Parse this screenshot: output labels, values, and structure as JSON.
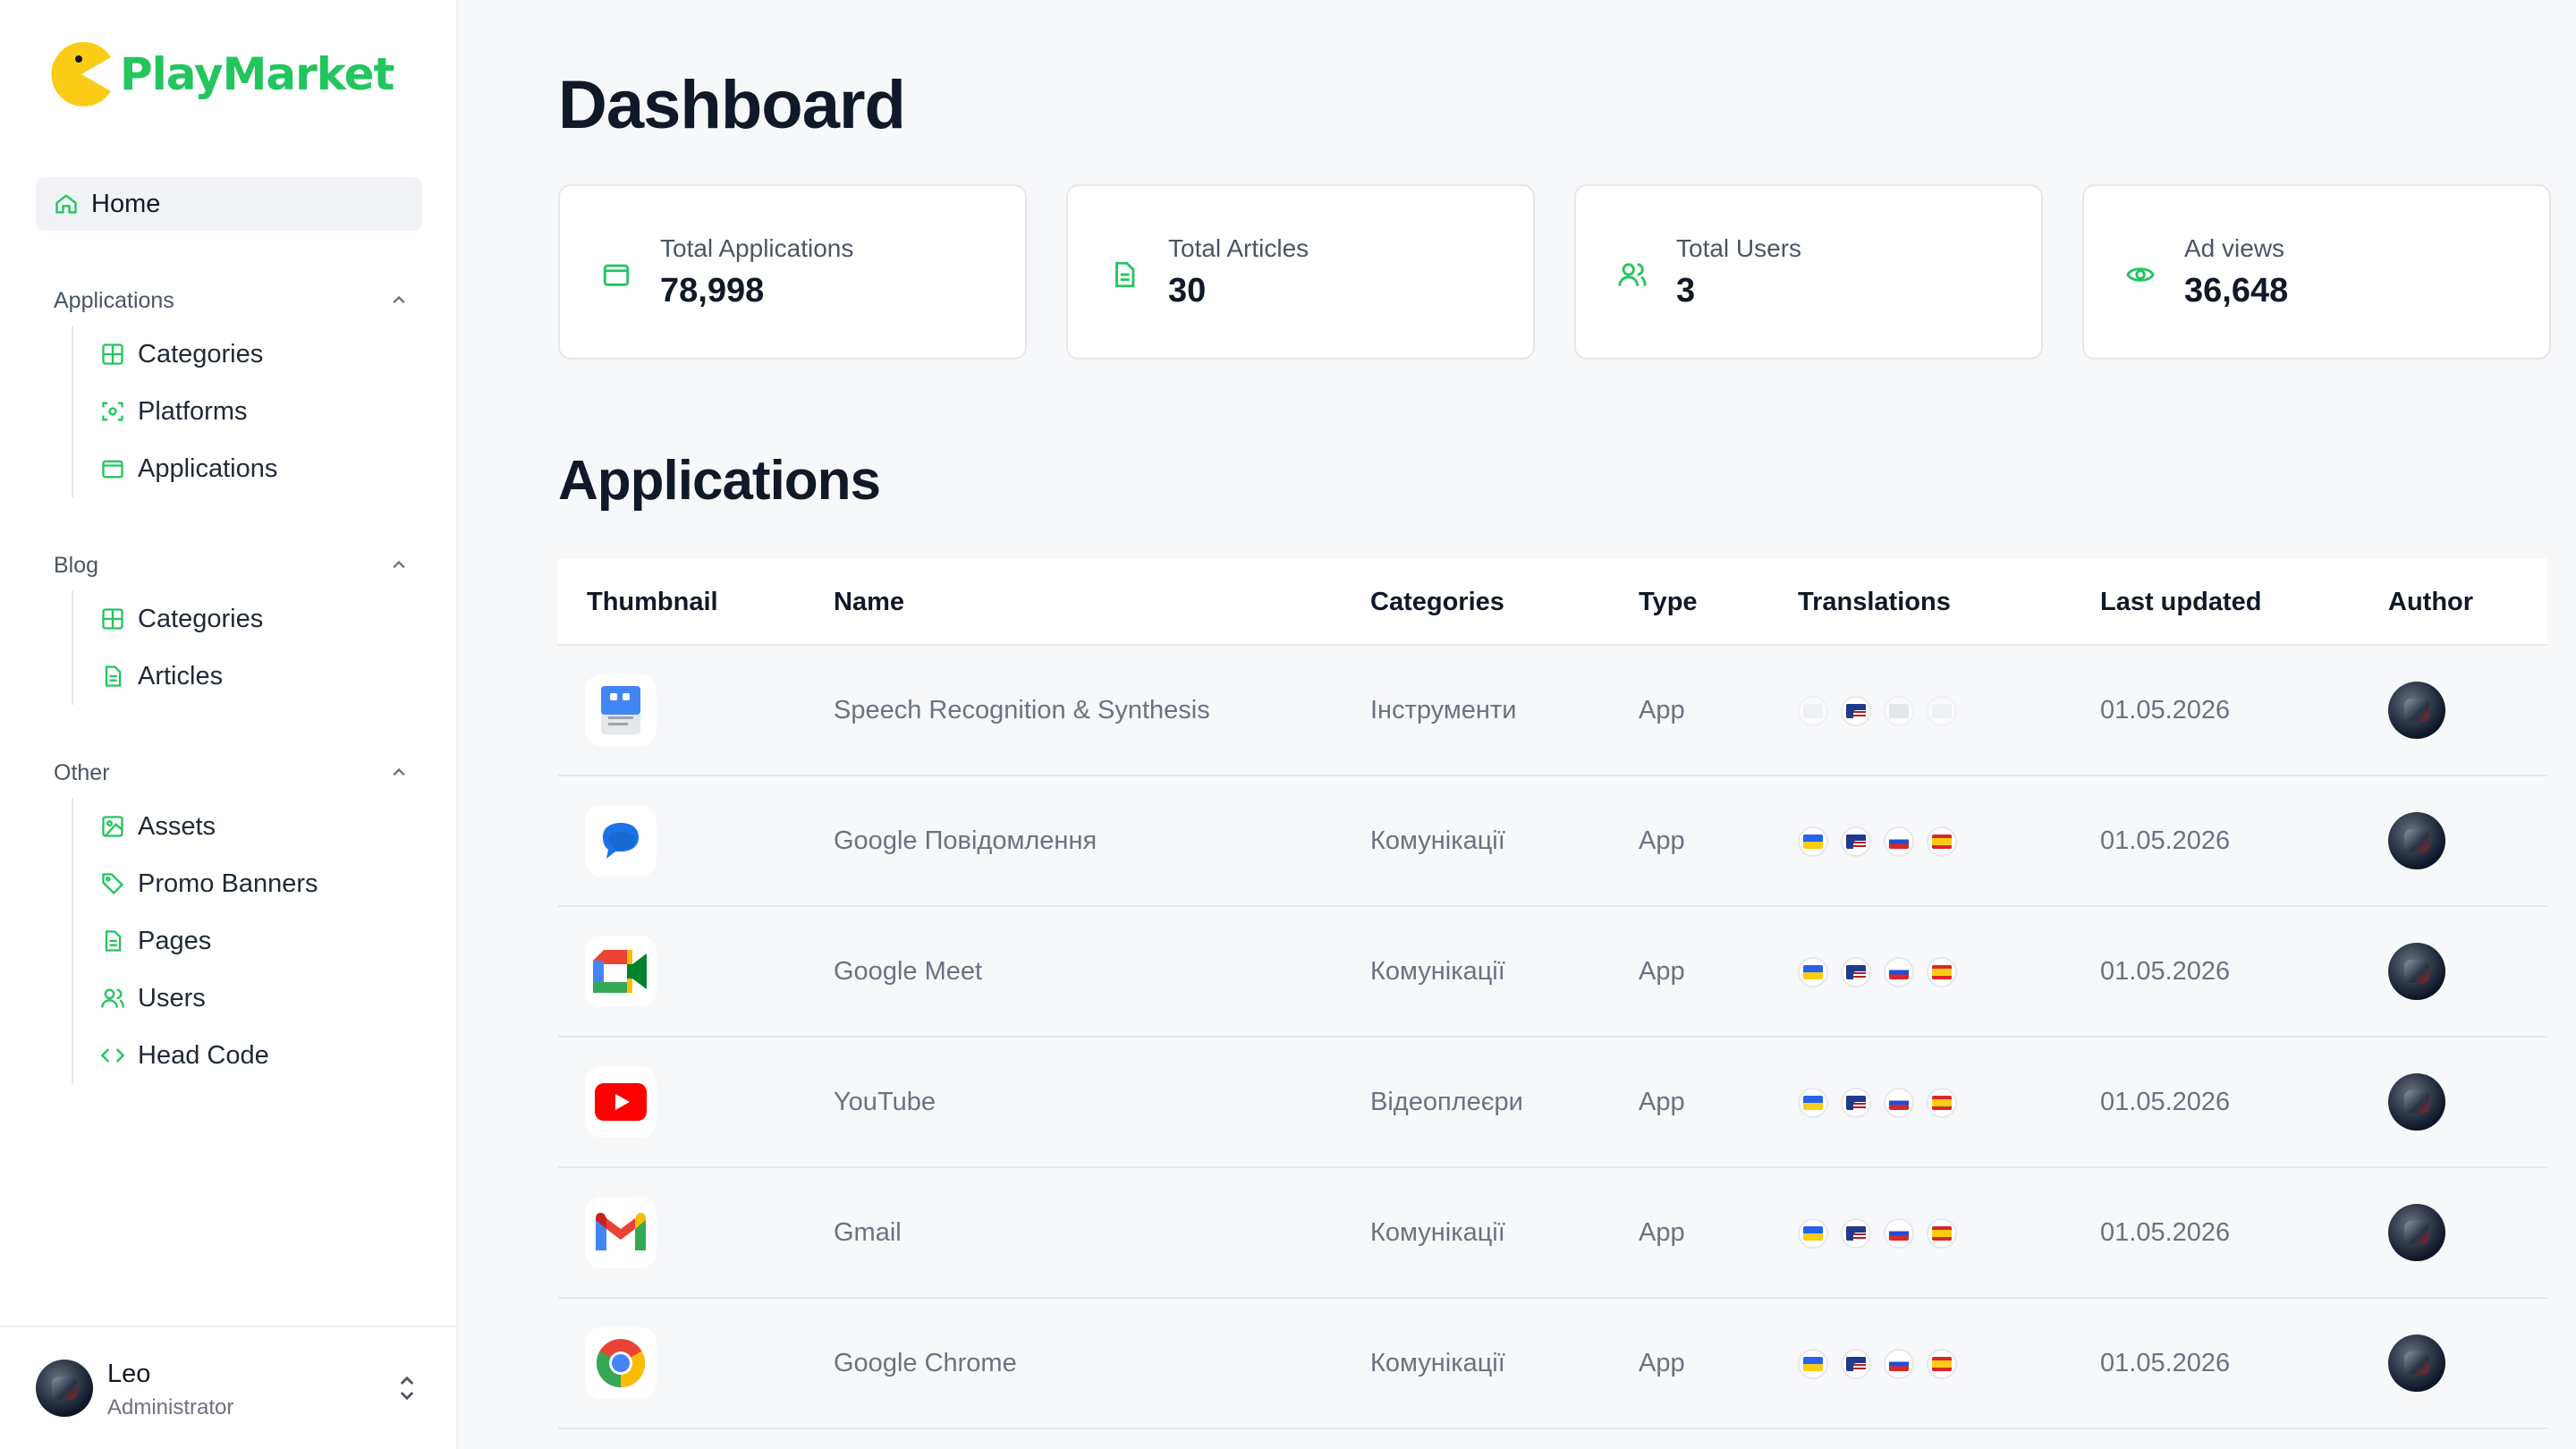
{
  "brand": {
    "name": "PlayMarket",
    "accent": "#22c55e",
    "logo_color": "#facc15"
  },
  "sidebar": {
    "home": {
      "label": "Home",
      "icon": "home-icon"
    },
    "sections": [
      {
        "title": "Applications",
        "items": [
          {
            "label": "Categories",
            "icon": "grid-icon"
          },
          {
            "label": "Platforms",
            "icon": "scan-icon"
          },
          {
            "label": "Applications",
            "icon": "window-icon"
          }
        ]
      },
      {
        "title": "Blog",
        "items": [
          {
            "label": "Categories",
            "icon": "grid-icon"
          },
          {
            "label": "Articles",
            "icon": "document-icon"
          }
        ]
      },
      {
        "title": "Other",
        "items": [
          {
            "label": "Assets",
            "icon": "image-icon"
          },
          {
            "label": "Promo Banners",
            "icon": "tag-icon"
          },
          {
            "label": "Pages",
            "icon": "document-icon"
          },
          {
            "label": "Users",
            "icon": "users-icon"
          },
          {
            "label": "Head Code",
            "icon": "code-icon"
          }
        ]
      }
    ],
    "user": {
      "name": "Leo",
      "role": "Administrator"
    }
  },
  "page": {
    "title": "Dashboard",
    "section_title": "Applications"
  },
  "stats": [
    {
      "label": "Total Applications",
      "value": "78,998",
      "icon": "window-icon"
    },
    {
      "label": "Total Articles",
      "value": "30",
      "icon": "document-icon"
    },
    {
      "label": "Total Users",
      "value": "3",
      "icon": "users-icon"
    },
    {
      "label": "Ad views",
      "value": "36,648",
      "icon": "eye-icon"
    }
  ],
  "table": {
    "columns": [
      "Thumbnail",
      "Name",
      "Categories",
      "Type",
      "Translations",
      "Last updated",
      "Author"
    ],
    "rows": [
      {
        "name": "Speech Recognition & Synthesis",
        "category": "Інструменти",
        "type": "App",
        "updated": "01.05.2026",
        "thumb": "speech-app-icon",
        "flags": [
          "none",
          "us",
          "none",
          "none"
        ]
      },
      {
        "name": "Google Повідомлення",
        "category": "Комунікації",
        "type": "App",
        "updated": "01.05.2026",
        "thumb": "messages-app-icon",
        "flags": [
          "ua",
          "us",
          "ru",
          "es"
        ]
      },
      {
        "name": "Google Meet",
        "category": "Комунікації",
        "type": "App",
        "updated": "01.05.2026",
        "thumb": "meet-app-icon",
        "flags": [
          "ua",
          "us",
          "ru",
          "es"
        ]
      },
      {
        "name": "YouTube",
        "category": "Відеоплеєри",
        "type": "App",
        "updated": "01.05.2026",
        "thumb": "youtube-app-icon",
        "flags": [
          "ua",
          "us",
          "ru",
          "es"
        ]
      },
      {
        "name": "Gmail",
        "category": "Комунікації",
        "type": "App",
        "updated": "01.05.2026",
        "thumb": "gmail-app-icon",
        "flags": [
          "ua",
          "us",
          "ru",
          "es"
        ]
      },
      {
        "name": "Google Chrome",
        "category": "Комунікації",
        "type": "App",
        "updated": "01.05.2026",
        "thumb": "chrome-app-icon",
        "flags": [
          "ua",
          "us",
          "ru",
          "es"
        ]
      }
    ]
  }
}
